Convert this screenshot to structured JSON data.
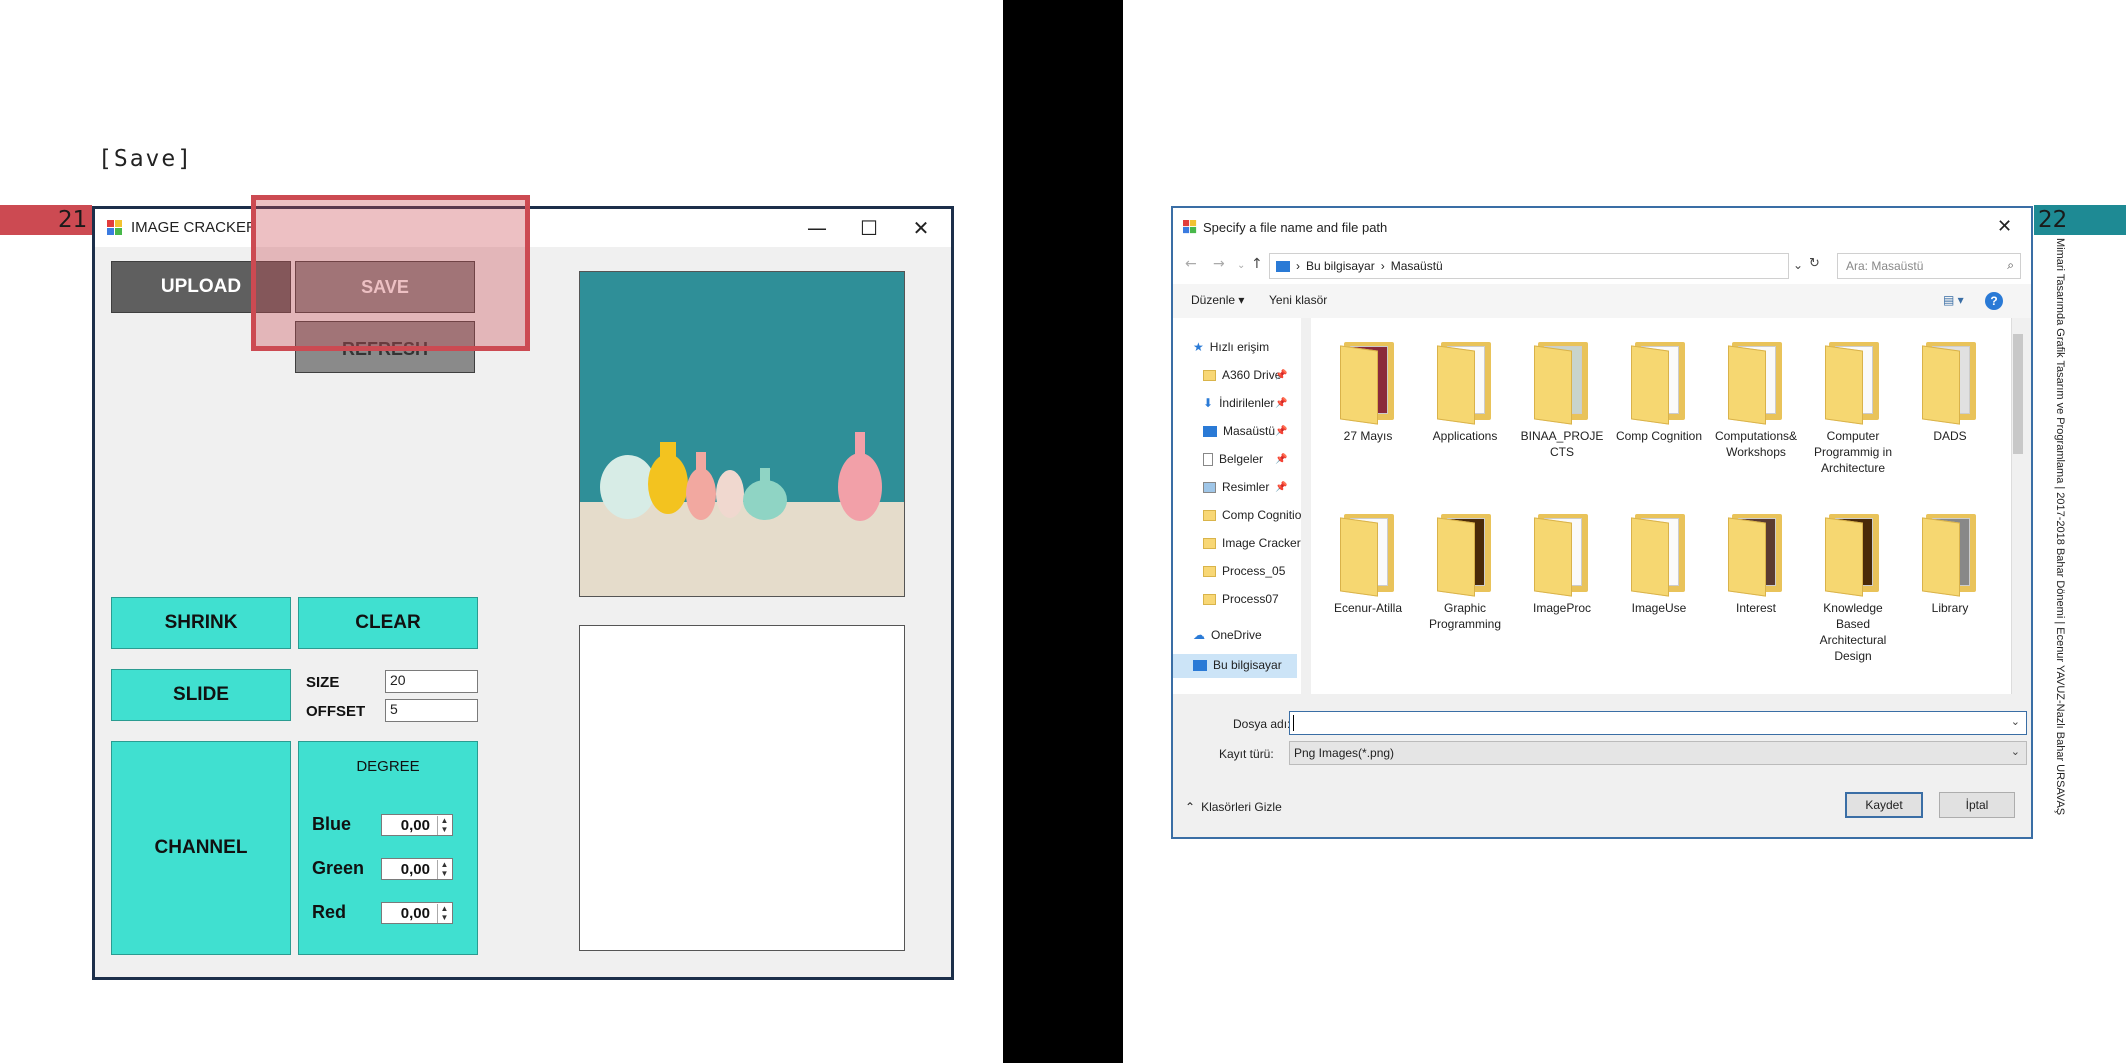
{
  "left_slide": {
    "caption": "[Save]",
    "slide_number": "21",
    "window": {
      "title": "IMAGE CRACKER",
      "controls": {
        "minimize": "—",
        "maximize": "☐",
        "close": "✕"
      },
      "buttons": {
        "upload": "UPLOAD",
        "save": "SAVE",
        "refresh": "REFRESH",
        "shrink": "SHRINK",
        "clear": "CLEAR",
        "slide": "SLIDE",
        "channel": "CHANNEL"
      },
      "size_label": "SIZE",
      "size_value": "20",
      "offset_label": "OFFSET",
      "offset_value": "5",
      "degree_label": "DEGREE",
      "channels": [
        {
          "label": "Blue",
          "value": "0,00"
        },
        {
          "label": "Green",
          "value": "0,00"
        },
        {
          "label": "Red",
          "value": "0,00"
        }
      ]
    }
  },
  "right_slide": {
    "slide_number": "22",
    "vertical_text": "Mimari Tasarımda Grafik Tasarım ve Programlama | 2017-2018 Bahar Dönemi | Ecenur YAVUZ-Nazlı Bahar URSAVAŞ",
    "dialog": {
      "title": "Specify a file name and file path",
      "close": "✕",
      "breadcrumb": [
        "Bu bilgisayar",
        "Masaüstü"
      ],
      "search_placeholder": "Ara: Masaüstü",
      "toolbar": {
        "organize": "Düzenle ▾",
        "new_folder": "Yeni klasör"
      },
      "nav_items": [
        {
          "label": "Hızlı erişim"
        },
        {
          "label": "A360 Drive"
        },
        {
          "label": "İndirilenler"
        },
        {
          "label": "Masaüstü"
        },
        {
          "label": "Belgeler"
        },
        {
          "label": "Resimler"
        },
        {
          "label": "Comp Cognition"
        },
        {
          "label": "Image Cracker"
        },
        {
          "label": "Process_05"
        },
        {
          "label": "Process07"
        },
        {
          "label": "OneDrive"
        },
        {
          "label": "Bu bilgisayar"
        }
      ],
      "files": [
        {
          "name": "27 Mayıs"
        },
        {
          "name": "Applications"
        },
        {
          "name": "BINAA_PROJECTS"
        },
        {
          "name": "Comp Cognition"
        },
        {
          "name": "Computations& Workshops"
        },
        {
          "name": "Computer Programmig in Architecture"
        },
        {
          "name": "DADS"
        },
        {
          "name": "Ecenur-Atilla"
        },
        {
          "name": "Graphic Programming"
        },
        {
          "name": "ImageProc"
        },
        {
          "name": "ImageUse"
        },
        {
          "name": "Interest"
        },
        {
          "name": "Knowledge Based Architectural Design"
        },
        {
          "name": "Library"
        }
      ],
      "file_name_label": "Dosya adı:",
      "file_name_value": "",
      "file_type_label": "Kayıt türü:",
      "file_type_value": "Png Images(*.png)",
      "hide_folders": "Klasörleri Gizle",
      "save_button": "Kaydet",
      "cancel_button": "İptal"
    }
  }
}
